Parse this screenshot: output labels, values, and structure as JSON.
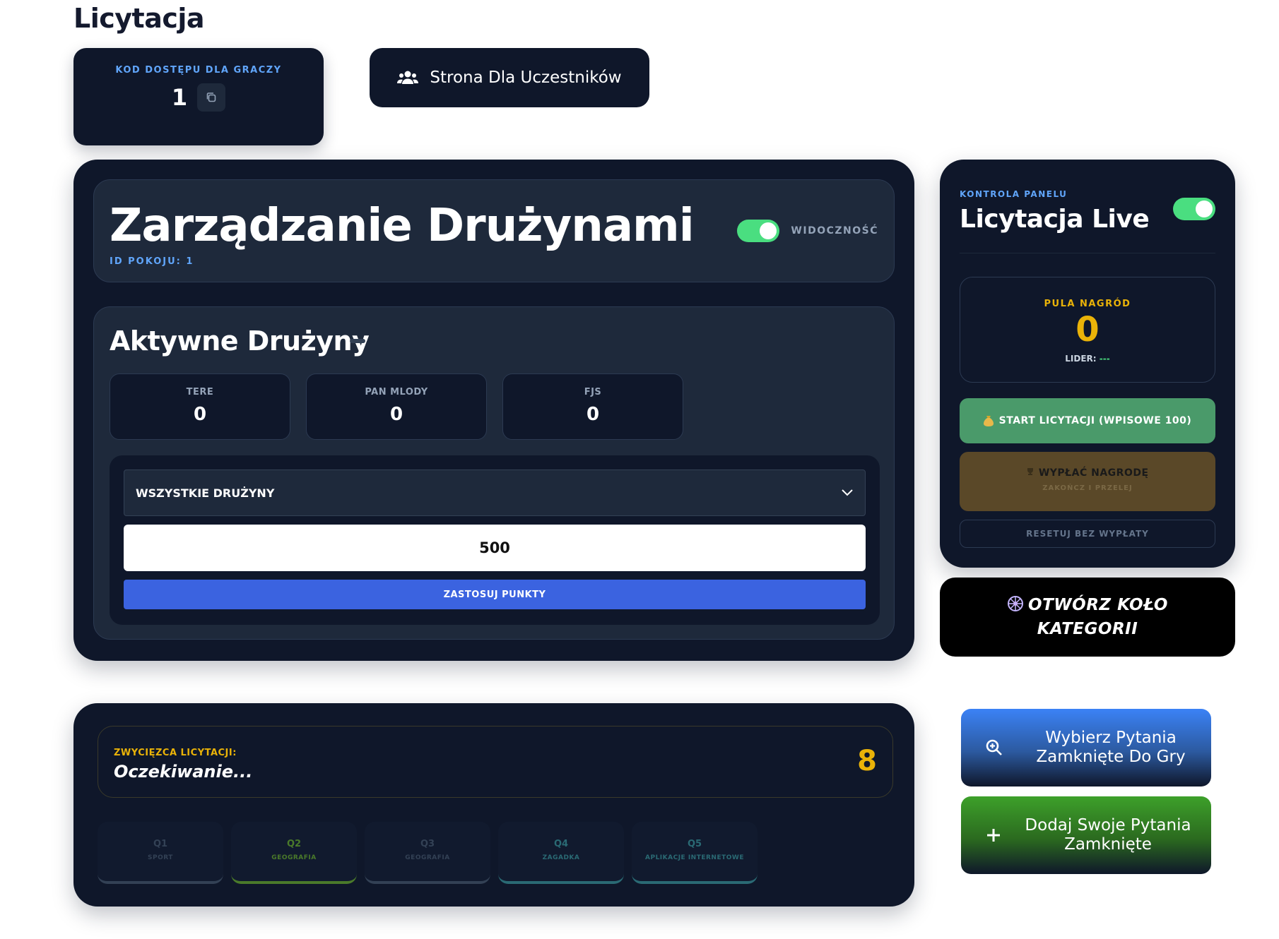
{
  "page": {
    "title": "Licytacja"
  },
  "access": {
    "label": "KOD DOSTĘPU DLA GRACZY",
    "code": "1"
  },
  "participants_button": {
    "label": "Strona Dla Uczestników"
  },
  "team_management": {
    "title": "Zarządzanie Drużynami",
    "room_id": "ID POKOJU: 1",
    "visibility_label": "WIDOCZNOŚĆ",
    "visibility_on": true,
    "active_title": "Aktywne Drużyny",
    "teams": [
      {
        "name": "TERE",
        "score": "0"
      },
      {
        "name": "PAN MLODY",
        "score": "0"
      },
      {
        "name": "FJS",
        "score": "0"
      }
    ],
    "select_value": "WSZYSTKIE DRUŻYNY",
    "points_value": "500",
    "apply_label": "ZASTOSUJ PUNKTY"
  },
  "panel": {
    "label": "KONTROLA PANELU",
    "title": "Licytacja Live",
    "live_on": true,
    "prize_label": "PULA NAGRÓD",
    "prize_value": "0",
    "leader_label": "LIDER:",
    "leader_value": "---",
    "start_label": "START LICYTACJI (WPISOWE 100)",
    "payout_label": "WYPŁAĆ NAGRODĘ",
    "payout_sub": "ZAKOŃCZ I PRZELEJ",
    "reset_label": "RESETUJ BEZ WYPŁATY"
  },
  "wheel": {
    "line1": "OTWÓRZ KOŁO",
    "line2": "KATEGORII"
  },
  "winner": {
    "label": "ZWYCIĘZCA LICYTACJI:",
    "value": "Oczekiwanie...",
    "number": "8"
  },
  "questions": [
    {
      "n": "Q1",
      "cat": "SPORT",
      "color": "#334155",
      "text": "#334155"
    },
    {
      "n": "Q2",
      "cat": "GEOGRAFIA",
      "color": "#4a7a2a",
      "text": "#4a7a2a"
    },
    {
      "n": "Q3",
      "cat": "GEOGRAFIA",
      "color": "#334155",
      "text": "#334155"
    },
    {
      "n": "Q4",
      "cat": "ZAGADKA",
      "color": "#2a6a74",
      "text": "#2a6a74"
    },
    {
      "n": "Q5",
      "cat": "APLIKACJE INTERNETOWE",
      "color": "#2a6a74",
      "text": "#2a6a74"
    }
  ],
  "pick_button": {
    "label": "Wybierz Pytania Zamknięte Do Gry"
  },
  "add_button": {
    "label": "Dodaj Swoje Pytania Zamknięte"
  }
}
